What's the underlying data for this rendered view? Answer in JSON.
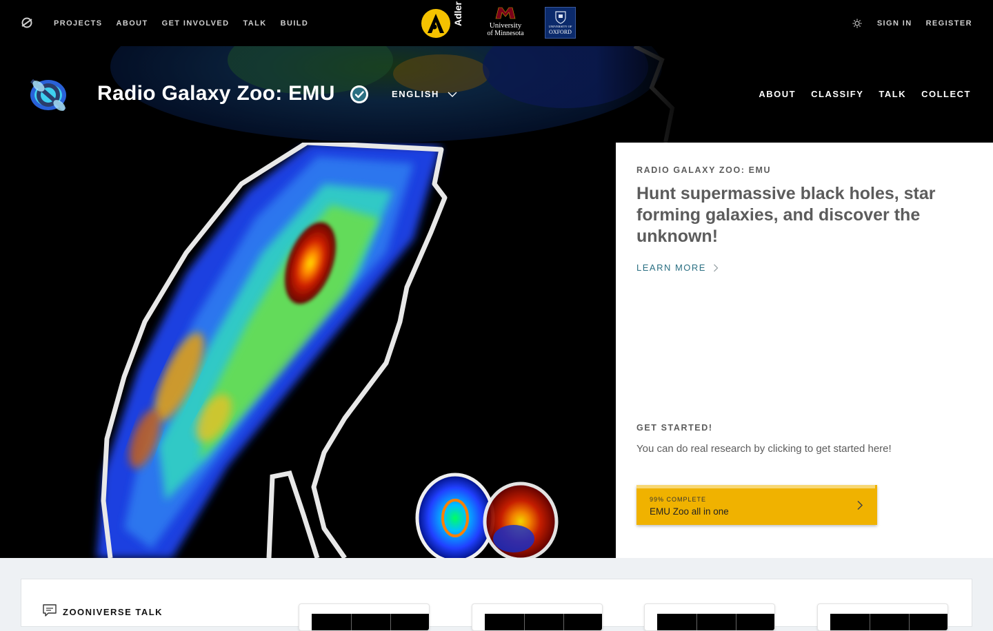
{
  "topbar": {
    "nav": [
      "PROJECTS",
      "ABOUT",
      "GET INVOLVED",
      "TALK",
      "BUILD"
    ],
    "sign_in": "SIGN IN",
    "register": "REGISTER",
    "partners": {
      "adler": "Adler",
      "umn_line1": "University",
      "umn_line2": "of Minnesota",
      "oxford_line1": "UNIVERSITY OF",
      "oxford_line2": "OXFORD"
    }
  },
  "project": {
    "title": "Radio Galaxy Zoo: EMU",
    "language": "ENGLISH",
    "nav": [
      "ABOUT",
      "CLASSIFY",
      "TALK",
      "COLLECT"
    ]
  },
  "hero": {
    "eyebrow": "RADIO GALAXY ZOO: EMU",
    "headline": "Hunt supermassive black holes, star forming galaxies, and discover the unknown!",
    "learn_more": "LEARN MORE",
    "get_started": "GET STARTED!",
    "get_started_text": "You can do real research by clicking to get started here!",
    "workflow": {
      "complete_label": "99% COMPLETE",
      "progress": 0.99,
      "name": "EMU Zoo all in one"
    }
  },
  "talk": {
    "title": "ZOONIVERSE TALK"
  },
  "colors": {
    "accent_yellow": "#f0b200",
    "link_teal": "#2a6f82",
    "text_gray": "#5c5c5c"
  }
}
